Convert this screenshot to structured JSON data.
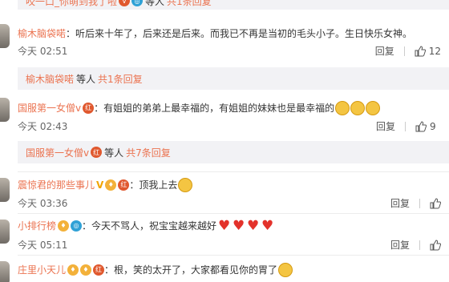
{
  "top_partial": {
    "author": "咬一口_你萌到我了啦",
    "suffix": "等人",
    "replies": "共1条回复"
  },
  "comments": [
    {
      "author": "榆木脑袋喏",
      "text": "：听后来十年了，后来还是后来。而我已不再是当初的毛头小子。生日快乐女神。",
      "time": "今天 02:51",
      "reply_label": "回复",
      "likes": "12",
      "sub": {
        "author": "榆木脑袋喏",
        "suffix": "等人",
        "replies": "共1条回复"
      }
    },
    {
      "author": "国服第一女僧v",
      "text": "：有姐姐的弟弟上最幸福的，有姐姐的妹妹也是最幸福的",
      "time": "今天 02:43",
      "reply_label": "回复",
      "likes": "9",
      "sub": {
        "author": "国服第一女僧v",
        "suffix": "等人",
        "replies": "共7条回复"
      }
    },
    {
      "author": "震惊君的那些事儿",
      "text": "：顶我上去",
      "time": "今天 03:36",
      "reply_label": "回复",
      "likes": ""
    },
    {
      "author": "小排行榜",
      "text": "：今天不骂人，祝宝宝越来越好",
      "time": "今天 05:11",
      "reply_label": "回复",
      "likes": ""
    },
    {
      "author": "庄里小天儿",
      "text": "：根，笑的太开了，大家都看见你的胃了",
      "time": "",
      "reply_label": "",
      "likes": ""
    }
  ],
  "colors": {
    "link": "#eb7350",
    "subbox": "#f2f2f5"
  },
  "icons": {
    "like": "thumbs-up-icon",
    "emoji_face": "grin-emoji-icon",
    "heart": "heart-emoji-icon"
  }
}
